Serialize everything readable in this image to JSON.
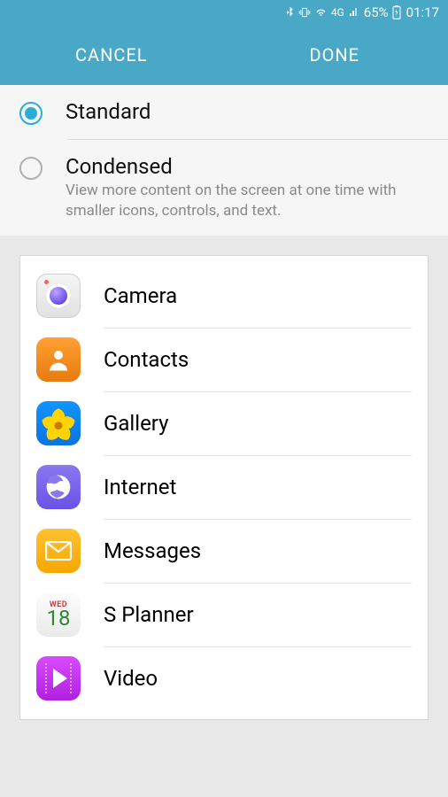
{
  "statusbar": {
    "network": "4G",
    "battery": "65%",
    "time": "01:17"
  },
  "header": {
    "cancel": "CANCEL",
    "done": "DONE"
  },
  "options": {
    "standard": {
      "title": "Standard"
    },
    "condensed": {
      "title": "Condensed",
      "subtitle": "View more content on the screen at one time with smaller icons, controls, and text."
    }
  },
  "apps": {
    "camera": "Camera",
    "contacts": "Contacts",
    "gallery": "Gallery",
    "internet": "Internet",
    "messages": "Messages",
    "splanner": "S Planner",
    "splanner_day": "WED",
    "splanner_date": "18",
    "video": "Video"
  }
}
